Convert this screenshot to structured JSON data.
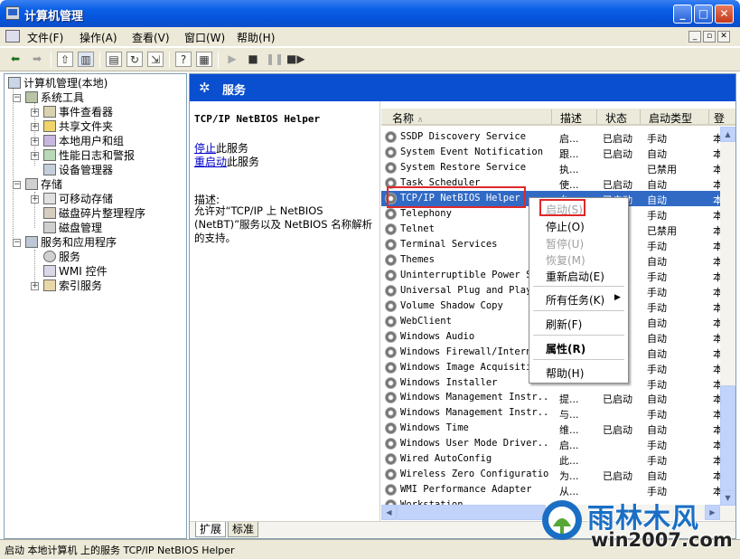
{
  "window": {
    "title": "计算机管理",
    "controls": [
      "_",
      "□",
      "✕"
    ]
  },
  "menu": [
    "文件(F)",
    "操作(A)",
    "查看(V)",
    "窗口(W)",
    "帮助(H)"
  ],
  "tree": {
    "root": "计算机管理(本地)",
    "items": [
      "系统工具",
      "事件查看器",
      "共享文件夹",
      "本地用户和组",
      "性能日志和警报",
      "设备管理器",
      "存储",
      "可移动存储",
      "磁盘碎片整理程序",
      "磁盘管理",
      "服务和应用程序",
      "服务",
      "WMI 控件",
      "索引服务"
    ]
  },
  "banner": {
    "title": "服务"
  },
  "detail": {
    "service_name": "TCP/IP NetBIOS Helper",
    "stop_link": "停止",
    "stop_suffix": "此服务",
    "restart_link": "重启动",
    "restart_suffix": "此服务",
    "desc_label": "描述:",
    "desc_text": "允许对“TCP/IP 上 NetBIOS (NetBT)”服务以及 NetBIOS 名称解析的支持。"
  },
  "list": {
    "columns": [
      "名称",
      "描述",
      "状态",
      "启动类型",
      "登"
    ],
    "rows": [
      {
        "name": "SSDP Discovery Service",
        "desc": "启...",
        "status": "已启动",
        "startup": "手动",
        "logon": "本"
      },
      {
        "name": "System Event Notification",
        "desc": "跟...",
        "status": "已启动",
        "startup": "自动",
        "logon": "本"
      },
      {
        "name": "System Restore Service",
        "desc": "执...",
        "status": "",
        "startup": "已禁用",
        "logon": "本"
      },
      {
        "name": "Task Scheduler",
        "desc": "使...",
        "status": "已启动",
        "startup": "自动",
        "logon": "本"
      },
      {
        "name": "TCP/IP NetBIOS Helper",
        "desc": "允...",
        "status": "已启动",
        "startup": "自动",
        "logon": "本"
      },
      {
        "name": "Telephony",
        "desc": "",
        "status": "",
        "startup": "手动",
        "logon": "本"
      },
      {
        "name": "Telnet",
        "desc": "",
        "status": "",
        "startup": "已禁用",
        "logon": "本"
      },
      {
        "name": "Terminal Services",
        "desc": "",
        "status": "",
        "startup": "手动",
        "logon": "本"
      },
      {
        "name": "Themes",
        "desc": "",
        "status": "",
        "startup": "自动",
        "logon": "本"
      },
      {
        "name": "Uninterruptible Power Su",
        "desc": "",
        "status": "",
        "startup": "手动",
        "logon": "本"
      },
      {
        "name": "Universal Plug and Play",
        "desc": "",
        "status": "",
        "startup": "手动",
        "logon": "本"
      },
      {
        "name": "Volume Shadow Copy",
        "desc": "",
        "status": "",
        "startup": "手动",
        "logon": "本"
      },
      {
        "name": "WebClient",
        "desc": "",
        "status": "",
        "startup": "自动",
        "logon": "本"
      },
      {
        "name": "Windows Audio",
        "desc": "",
        "status": "",
        "startup": "自动",
        "logon": "本"
      },
      {
        "name": "Windows Firewall/Interne",
        "desc": "",
        "status": "",
        "startup": "自动",
        "logon": "本"
      },
      {
        "name": "Windows Image Acquisitio",
        "desc": "",
        "status": "",
        "startup": "手动",
        "logon": "本"
      },
      {
        "name": "Windows Installer",
        "desc": "",
        "status": "",
        "startup": "手动",
        "logon": "本"
      },
      {
        "name": "Windows Management Instr...",
        "desc": "提...",
        "status": "已启动",
        "startup": "自动",
        "logon": "本"
      },
      {
        "name": "Windows Management Instr...",
        "desc": "与...",
        "status": "",
        "startup": "手动",
        "logon": "本"
      },
      {
        "name": "Windows Time",
        "desc": "维...",
        "status": "已启动",
        "startup": "自动",
        "logon": "本"
      },
      {
        "name": "Windows User Mode Driver...",
        "desc": "启...",
        "status": "",
        "startup": "手动",
        "logon": "本"
      },
      {
        "name": "Wired AutoConfig",
        "desc": "此...",
        "status": "",
        "startup": "手动",
        "logon": "本"
      },
      {
        "name": "Wireless Zero Configuration",
        "desc": "为...",
        "status": "已启动",
        "startup": "自动",
        "logon": "本"
      },
      {
        "name": "WMI Performance Adapter",
        "desc": "从...",
        "status": "",
        "startup": "手动",
        "logon": "本"
      },
      {
        "name": "Workstation",
        "desc": "",
        "status": "",
        "startup": "",
        "logon": ""
      }
    ]
  },
  "context_menu": {
    "items": [
      {
        "label": "启动(S)",
        "disabled": true
      },
      {
        "label": "停止(O)",
        "disabled": false
      },
      {
        "label": "暂停(U)",
        "disabled": true
      },
      {
        "label": "恢复(M)",
        "disabled": true
      },
      {
        "label": "重新启动(E)",
        "disabled": false
      },
      {
        "label": "所有任务(K)",
        "disabled": false
      },
      {
        "label": "刷新(F)",
        "disabled": false
      },
      {
        "label": "属性(R)",
        "disabled": false,
        "bold": true
      },
      {
        "label": "帮助(H)",
        "disabled": false
      }
    ]
  },
  "tabs": [
    "扩展",
    "标准"
  ],
  "status": "启动 本地计算机 上的服务 TCP/IP NetBIOS Helper",
  "watermark": {
    "text": "雨林木风",
    "domain": "win2007.com"
  },
  "colors": {
    "titlebar": "#0553da",
    "selection": "#316ac5",
    "banner": "#0a4fd0",
    "highlight_box": "#e0282a"
  }
}
